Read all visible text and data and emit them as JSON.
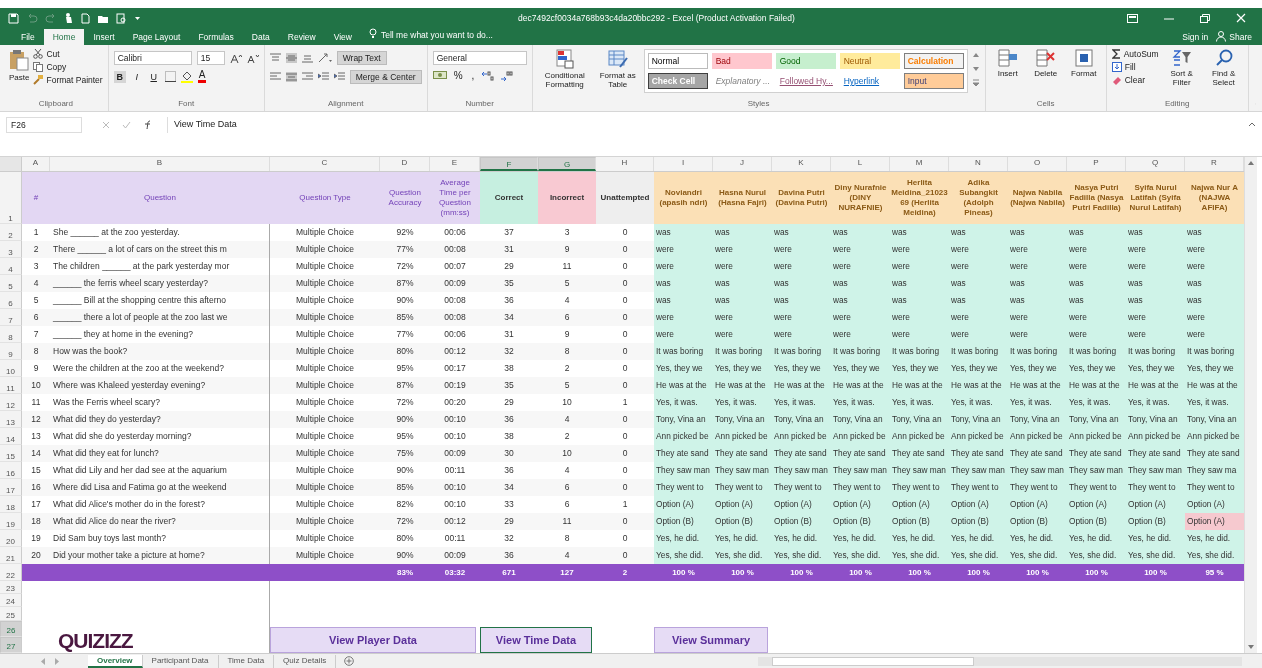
{
  "window": {
    "title": "dec7492cf0034a768b93c4da20bbc292 - Excel (Product Activation Failed)"
  },
  "menu_tabs": [
    {
      "label": "File",
      "selected": false
    },
    {
      "label": "Home",
      "selected": true
    },
    {
      "label": "Insert",
      "selected": false
    },
    {
      "label": "Page Layout",
      "selected": false
    },
    {
      "label": "Formulas",
      "selected": false
    },
    {
      "label": "Data",
      "selected": false
    },
    {
      "label": "Review",
      "selected": false
    },
    {
      "label": "View",
      "selected": false
    }
  ],
  "tell_me": "Tell me what you want to do...",
  "account": {
    "sign_in": "Sign in",
    "share": "Share"
  },
  "ribbon": {
    "clipboard": {
      "paste": "Paste",
      "cut": "Cut",
      "copy": "Copy",
      "format_painter": "Format Painter",
      "label": "Clipboard"
    },
    "font": {
      "name": "Calibri",
      "size": "15",
      "bold": "B",
      "italic": "I",
      "underline": "U",
      "font_color": "A",
      "label": "Font"
    },
    "alignment": {
      "wrap": "Wrap Text",
      "merge": "Merge & Center",
      "label": "Alignment"
    },
    "number": {
      "format": "General",
      "percent": "%",
      "comma": ",",
      "label": "Number"
    },
    "styles": {
      "conditional": "Conditional Formatting",
      "format_table": "Format as Table",
      "label": "Styles",
      "gallery": [
        {
          "label": "Normal",
          "kind": "normal"
        },
        {
          "label": "Bad",
          "kind": "bad"
        },
        {
          "label": "Good",
          "kind": "good"
        },
        {
          "label": "Neutral",
          "kind": "neutral"
        },
        {
          "label": "Calculation",
          "kind": "calculation"
        },
        {
          "label": "Check Cell",
          "kind": "check"
        },
        {
          "label": "Explanatory ...",
          "kind": "explanatory"
        },
        {
          "label": "Followed Hy...",
          "kind": "followed"
        },
        {
          "label": "Hyperlink",
          "kind": "hyperlink"
        },
        {
          "label": "Input",
          "kind": "input"
        }
      ]
    },
    "cells": {
      "insert": "Insert",
      "delete": "Delete",
      "format": "Format",
      "label": "Cells"
    },
    "editing": {
      "autosum": "AutoSum",
      "fill": "Fill",
      "clear": "Clear",
      "sort": "Sort & Filter",
      "find": "Find & Select",
      "label": "Editing"
    }
  },
  "formula_bar": {
    "name_box": "F26",
    "content": "View Time Data"
  },
  "sheet": {
    "columns": [
      {
        "letter": "A",
        "selected": false
      },
      {
        "letter": "B",
        "selected": false
      },
      {
        "letter": "C",
        "selected": false
      },
      {
        "letter": "D",
        "selected": false
      },
      {
        "letter": "E",
        "selected": false
      },
      {
        "letter": "F",
        "selected": true
      },
      {
        "letter": "G",
        "selected": true
      },
      {
        "letter": "H",
        "selected": false
      },
      {
        "letter": "I",
        "selected": false
      },
      {
        "letter": "J",
        "selected": false
      },
      {
        "letter": "K",
        "selected": false
      },
      {
        "letter": "L",
        "selected": false
      },
      {
        "letter": "M",
        "selected": false
      },
      {
        "letter": "N",
        "selected": false
      },
      {
        "letter": "O",
        "selected": false
      },
      {
        "letter": "P",
        "selected": false
      },
      {
        "letter": "Q",
        "selected": false
      },
      {
        "letter": "R",
        "selected": false
      }
    ],
    "row_headers": [
      {
        "label": "1",
        "selected": false
      },
      {
        "label": "2",
        "selected": false
      },
      {
        "label": "3",
        "selected": false
      },
      {
        "label": "4",
        "selected": false
      },
      {
        "label": "5",
        "selected": false
      },
      {
        "label": "6",
        "selected": false
      },
      {
        "label": "7",
        "selected": false
      },
      {
        "label": "8",
        "selected": false
      },
      {
        "label": "9",
        "selected": false
      },
      {
        "label": "10",
        "selected": false
      },
      {
        "label": "11",
        "selected": false
      },
      {
        "label": "12",
        "selected": false
      },
      {
        "label": "13",
        "selected": false
      },
      {
        "label": "14",
        "selected": false
      },
      {
        "label": "15",
        "selected": false
      },
      {
        "label": "16",
        "selected": false
      },
      {
        "label": "17",
        "selected": false
      },
      {
        "label": "18",
        "selected": false
      },
      {
        "label": "19",
        "selected": false
      },
      {
        "label": "20",
        "selected": false
      },
      {
        "label": "21",
        "selected": false
      },
      {
        "label": "22",
        "selected": false
      },
      {
        "label": "23",
        "selected": false
      },
      {
        "label": "24",
        "selected": false
      },
      {
        "label": "25",
        "selected": false
      },
      {
        "label": "26",
        "selected": true
      },
      {
        "label": "27",
        "selected": true
      }
    ],
    "header": [
      {
        "label": "#",
        "kind": "info"
      },
      {
        "label": "Question",
        "kind": "info"
      },
      {
        "label": "Question Type",
        "kind": "info"
      },
      {
        "label": "Question Accuracy",
        "kind": "info"
      },
      {
        "label": "Average Time per Question (mm:ss)",
        "kind": "info"
      },
      {
        "label": "Correct",
        "kind": "correct"
      },
      {
        "label": "Incorrect",
        "kind": "incorrect"
      },
      {
        "label": "Unattempted",
        "kind": "unattempted"
      }
    ],
    "players": [
      "Noviandri (apasih ndri)",
      "Hasna Nurul (Hasna Fajri)",
      "Davina Putri (Davina Putri)",
      "Diny Nurafnie (DINY NURAFNIE)",
      "Herlita Meidina_2102369 (Herlita Meidina)",
      "Adika Subangkit (Adolph Pineas)",
      "Najwa Nabila (Najwa Nabila)",
      "Nasya Putri Fadilla (Nasya Putri Fadilla)",
      "Syifa Nurul Latifah (Syifa Nurul Latifah)",
      "Najwa Nur A (NAJWA AFIFA)"
    ],
    "rows": [
      {
        "num": "1",
        "question": "She ______ at the zoo yesterday.",
        "type": "Multiple Choice",
        "accuracy": "92%",
        "time": "00:06",
        "correct": "37",
        "incorrect": "3",
        "unattempted": "0",
        "answers": [
          {
            "text": "was",
            "correct": true
          },
          {
            "text": "was",
            "correct": true
          },
          {
            "text": "was",
            "correct": true
          },
          {
            "text": "was",
            "correct": true
          },
          {
            "text": "was",
            "correct": true
          },
          {
            "text": "was",
            "correct": true
          },
          {
            "text": "was",
            "correct": true
          },
          {
            "text": "was",
            "correct": true
          },
          {
            "text": "was",
            "correct": true
          },
          {
            "text": "was",
            "correct": true
          }
        ]
      },
      {
        "num": "2",
        "question": "There ______ a lot of cars on the street this m",
        "type": "Multiple Choice",
        "accuracy": "77%",
        "time": "00:08",
        "correct": "31",
        "incorrect": "9",
        "unattempted": "0",
        "answers": [
          {
            "text": "were",
            "correct": true
          },
          {
            "text": "were",
            "correct": true
          },
          {
            "text": "were",
            "correct": true
          },
          {
            "text": "were",
            "correct": true
          },
          {
            "text": "were",
            "correct": true
          },
          {
            "text": "were",
            "correct": true
          },
          {
            "text": "were",
            "correct": true
          },
          {
            "text": "were",
            "correct": true
          },
          {
            "text": "were",
            "correct": true
          },
          {
            "text": "were",
            "correct": true
          }
        ]
      },
      {
        "num": "3",
        "question": "The children ______ at the park yesterday mor",
        "type": "Multiple Choice",
        "accuracy": "72%",
        "time": "00:07",
        "correct": "29",
        "incorrect": "11",
        "unattempted": "0",
        "answers": [
          {
            "text": "were",
            "correct": true
          },
          {
            "text": "were",
            "correct": true
          },
          {
            "text": "were",
            "correct": true
          },
          {
            "text": "were",
            "correct": true
          },
          {
            "text": "were",
            "correct": true
          },
          {
            "text": "were",
            "correct": true
          },
          {
            "text": "were",
            "correct": true
          },
          {
            "text": "were",
            "correct": true
          },
          {
            "text": "were",
            "correct": true
          },
          {
            "text": "were",
            "correct": true
          }
        ]
      },
      {
        "num": "4",
        "question": "______ the ferris wheel scary yesterday?",
        "type": "Multiple Choice",
        "accuracy": "87%",
        "time": "00:09",
        "correct": "35",
        "incorrect": "5",
        "unattempted": "0",
        "answers": [
          {
            "text": "was",
            "correct": true
          },
          {
            "text": "was",
            "correct": true
          },
          {
            "text": "was",
            "correct": true
          },
          {
            "text": "was",
            "correct": true
          },
          {
            "text": "was",
            "correct": true
          },
          {
            "text": "was",
            "correct": true
          },
          {
            "text": "was",
            "correct": true
          },
          {
            "text": "was",
            "correct": true
          },
          {
            "text": "was",
            "correct": true
          },
          {
            "text": "was",
            "correct": true
          }
        ]
      },
      {
        "num": "5",
        "question": "______ Bill at the shopping centre this afterno",
        "type": "Multiple Choice",
        "accuracy": "90%",
        "time": "00:08",
        "correct": "36",
        "incorrect": "4",
        "unattempted": "0",
        "answers": [
          {
            "text": "was",
            "correct": true
          },
          {
            "text": "was",
            "correct": true
          },
          {
            "text": "was",
            "correct": true
          },
          {
            "text": "was",
            "correct": true
          },
          {
            "text": "was",
            "correct": true
          },
          {
            "text": "was",
            "correct": true
          },
          {
            "text": "was",
            "correct": true
          },
          {
            "text": "was",
            "correct": true
          },
          {
            "text": "was",
            "correct": true
          },
          {
            "text": "was",
            "correct": true
          }
        ]
      },
      {
        "num": "6",
        "question": "______ there a lot of people at the zoo last we",
        "type": "Multiple Choice",
        "accuracy": "85%",
        "time": "00:08",
        "correct": "34",
        "incorrect": "6",
        "unattempted": "0",
        "answers": [
          {
            "text": "were",
            "correct": true
          },
          {
            "text": "were",
            "correct": true
          },
          {
            "text": "were",
            "correct": true
          },
          {
            "text": "were",
            "correct": true
          },
          {
            "text": "were",
            "correct": true
          },
          {
            "text": "were",
            "correct": true
          },
          {
            "text": "were",
            "correct": true
          },
          {
            "text": "were",
            "correct": true
          },
          {
            "text": "were",
            "correct": true
          },
          {
            "text": "were",
            "correct": true
          }
        ]
      },
      {
        "num": "7",
        "question": "______ they at home in the evening?",
        "type": "Multiple Choice",
        "accuracy": "77%",
        "time": "00:06",
        "correct": "31",
        "incorrect": "9",
        "unattempted": "0",
        "answers": [
          {
            "text": "were",
            "correct": true
          },
          {
            "text": "were",
            "correct": true
          },
          {
            "text": "were",
            "correct": true
          },
          {
            "text": "were",
            "correct": true
          },
          {
            "text": "were",
            "correct": true
          },
          {
            "text": "were",
            "correct": true
          },
          {
            "text": "were",
            "correct": true
          },
          {
            "text": "were",
            "correct": true
          },
          {
            "text": "were",
            "correct": true
          },
          {
            "text": "were",
            "correct": true
          }
        ]
      },
      {
        "num": "8",
        "question": "How was the book?",
        "type": "Multiple Choice",
        "accuracy": "80%",
        "time": "00:12",
        "correct": "32",
        "incorrect": "8",
        "unattempted": "0",
        "answers": [
          {
            "text": "It was boring",
            "correct": true
          },
          {
            "text": "It was boring",
            "correct": true
          },
          {
            "text": "It was boring",
            "correct": true
          },
          {
            "text": "It was boring",
            "correct": true
          },
          {
            "text": "It was boring",
            "correct": true
          },
          {
            "text": "It was boring",
            "correct": true
          },
          {
            "text": "It was boring",
            "correct": true
          },
          {
            "text": "It was boring",
            "correct": true
          },
          {
            "text": "It was boring",
            "correct": true
          },
          {
            "text": "It was boring",
            "correct": true
          }
        ]
      },
      {
        "num": "9",
        "question": "Were the children at the zoo at the weekend?",
        "type": "Multiple Choice",
        "accuracy": "95%",
        "time": "00:17",
        "correct": "38",
        "incorrect": "2",
        "unattempted": "0",
        "answers": [
          {
            "text": "Yes, they we",
            "correct": true
          },
          {
            "text": "Yes, they we",
            "correct": true
          },
          {
            "text": "Yes, they we",
            "correct": true
          },
          {
            "text": "Yes, they we",
            "correct": true
          },
          {
            "text": "Yes, they we",
            "correct": true
          },
          {
            "text": "Yes, they we",
            "correct": true
          },
          {
            "text": "Yes, they we",
            "correct": true
          },
          {
            "text": "Yes, they we",
            "correct": true
          },
          {
            "text": "Yes, they we",
            "correct": true
          },
          {
            "text": "Yes, they we",
            "correct": true
          }
        ]
      },
      {
        "num": "10",
        "question": "Where was Khaleed yesterday evening?",
        "type": "Multiple Choice",
        "accuracy": "87%",
        "time": "00:19",
        "correct": "35",
        "incorrect": "5",
        "unattempted": "0",
        "answers": [
          {
            "text": "He was at the",
            "correct": true
          },
          {
            "text": "He was at the",
            "correct": true
          },
          {
            "text": "He was at the",
            "correct": true
          },
          {
            "text": "He was at the",
            "correct": true
          },
          {
            "text": "He was at the",
            "correct": true
          },
          {
            "text": "He was at the",
            "correct": true
          },
          {
            "text": "He was at the",
            "correct": true
          },
          {
            "text": "He was at the",
            "correct": true
          },
          {
            "text": "He was at the",
            "correct": true
          },
          {
            "text": "He was at the",
            "correct": true
          }
        ]
      },
      {
        "num": "11",
        "question": "Was the Ferris wheel scary?",
        "type": "Multiple Choice",
        "accuracy": "72%",
        "time": "00:20",
        "correct": "29",
        "incorrect": "10",
        "unattempted": "1",
        "answers": [
          {
            "text": "Yes, it was.",
            "correct": true
          },
          {
            "text": "Yes, it was.",
            "correct": true
          },
          {
            "text": "Yes, it was.",
            "correct": true
          },
          {
            "text": "Yes, it was.",
            "correct": true
          },
          {
            "text": "Yes, it was.",
            "correct": true
          },
          {
            "text": "Yes, it was.",
            "correct": true
          },
          {
            "text": "Yes, it was.",
            "correct": true
          },
          {
            "text": "Yes, it was.",
            "correct": true
          },
          {
            "text": "Yes, it was.",
            "correct": true
          },
          {
            "text": "Yes, it was.",
            "correct": true
          }
        ]
      },
      {
        "num": "12",
        "question": "What did they do yesterday?",
        "type": "Multiple Choice",
        "accuracy": "90%",
        "time": "00:10",
        "correct": "36",
        "incorrect": "4",
        "unattempted": "0",
        "answers": [
          {
            "text": "Tony, Vina an",
            "correct": true
          },
          {
            "text": "Tony, Vina an",
            "correct": true
          },
          {
            "text": "Tony, Vina an",
            "correct": true
          },
          {
            "text": "Tony, Vina an",
            "correct": true
          },
          {
            "text": "Tony, Vina an",
            "correct": true
          },
          {
            "text": "Tony, Vina an",
            "correct": true
          },
          {
            "text": "Tony, Vina an",
            "correct": true
          },
          {
            "text": "Tony, Vina an",
            "correct": true
          },
          {
            "text": "Tony, Vina an",
            "correct": true
          },
          {
            "text": "Tony, Vina an",
            "correct": true
          }
        ]
      },
      {
        "num": "13",
        "question": "What did she do yesterday morning?",
        "type": "Multiple Choice",
        "accuracy": "95%",
        "time": "00:10",
        "correct": "38",
        "incorrect": "2",
        "unattempted": "0",
        "answers": [
          {
            "text": "Ann picked be",
            "correct": true
          },
          {
            "text": "Ann picked be",
            "correct": true
          },
          {
            "text": "Ann picked be",
            "correct": true
          },
          {
            "text": "Ann picked be",
            "correct": true
          },
          {
            "text": "Ann picked be",
            "correct": true
          },
          {
            "text": "Ann picked be",
            "correct": true
          },
          {
            "text": "Ann picked be",
            "correct": true
          },
          {
            "text": "Ann picked be",
            "correct": true
          },
          {
            "text": "Ann picked be",
            "correct": true
          },
          {
            "text": "Ann picked be",
            "correct": true
          }
        ]
      },
      {
        "num": "14",
        "question": "What did they eat for lunch?",
        "type": "Multiple Choice",
        "accuracy": "75%",
        "time": "00:09",
        "correct": "30",
        "incorrect": "10",
        "unattempted": "0",
        "answers": [
          {
            "text": "They ate sand",
            "correct": true
          },
          {
            "text": "They ate sand",
            "correct": true
          },
          {
            "text": "They ate sand",
            "correct": true
          },
          {
            "text": "They ate sand",
            "correct": true
          },
          {
            "text": "They ate sand",
            "correct": true
          },
          {
            "text": "They ate sand",
            "correct": true
          },
          {
            "text": "They ate sand",
            "correct": true
          },
          {
            "text": "They ate sand",
            "correct": true
          },
          {
            "text": "They ate sand",
            "correct": true
          },
          {
            "text": "They ate sand",
            "correct": true
          }
        ]
      },
      {
        "num": "15",
        "question": "What did Lily and her dad see at the aquarium",
        "type": "Multiple Choice",
        "accuracy": "90%",
        "time": "00:11",
        "correct": "36",
        "incorrect": "4",
        "unattempted": "0",
        "answers": [
          {
            "text": "They saw man",
            "correct": true
          },
          {
            "text": "They saw man",
            "correct": true
          },
          {
            "text": "They saw man",
            "correct": true
          },
          {
            "text": "They saw man",
            "correct": true
          },
          {
            "text": "They saw man",
            "correct": true
          },
          {
            "text": "They saw man",
            "correct": true
          },
          {
            "text": "They saw man",
            "correct": true
          },
          {
            "text": "They saw man",
            "correct": true
          },
          {
            "text": "They saw man",
            "correct": true
          },
          {
            "text": "They saw ma",
            "correct": true
          }
        ]
      },
      {
        "num": "16",
        "question": "Where did Lisa and Fatima go at the weekend",
        "type": "Multiple Choice",
        "accuracy": "85%",
        "time": "00:10",
        "correct": "34",
        "incorrect": "6",
        "unattempted": "0",
        "answers": [
          {
            "text": "They went to",
            "correct": true
          },
          {
            "text": "They went to",
            "correct": true
          },
          {
            "text": "They went to",
            "correct": true
          },
          {
            "text": "They went to",
            "correct": true
          },
          {
            "text": "They went to",
            "correct": true
          },
          {
            "text": "They went to",
            "correct": true
          },
          {
            "text": "They went to",
            "correct": true
          },
          {
            "text": "They went to",
            "correct": true
          },
          {
            "text": "They went to",
            "correct": true
          },
          {
            "text": "They went to",
            "correct": true
          }
        ]
      },
      {
        "num": "17",
        "question": "What did Alice's mother do in the forest?",
        "type": "Multiple Choice",
        "accuracy": "82%",
        "time": "00:10",
        "correct": "33",
        "incorrect": "6",
        "unattempted": "1",
        "answers": [
          {
            "text": "Option (A)",
            "correct": true
          },
          {
            "text": "Option (A)",
            "correct": true
          },
          {
            "text": "Option (A)",
            "correct": true
          },
          {
            "text": "Option (A)",
            "correct": true
          },
          {
            "text": "Option (A)",
            "correct": true
          },
          {
            "text": "Option (A)",
            "correct": true
          },
          {
            "text": "Option (A)",
            "correct": true
          },
          {
            "text": "Option (A)",
            "correct": true
          },
          {
            "text": "Option (A)",
            "correct": true
          },
          {
            "text": "Option (A)",
            "correct": true
          }
        ]
      },
      {
        "num": "18",
        "question": "What did Alice do near the river?",
        "type": "Multiple Choice",
        "accuracy": "72%",
        "time": "00:12",
        "correct": "29",
        "incorrect": "11",
        "unattempted": "0",
        "answers": [
          {
            "text": "Option (B)",
            "correct": true
          },
          {
            "text": "Option (B)",
            "correct": true
          },
          {
            "text": "Option (B)",
            "correct": true
          },
          {
            "text": "Option (B)",
            "correct": true
          },
          {
            "text": "Option (B)",
            "correct": true
          },
          {
            "text": "Option (B)",
            "correct": true
          },
          {
            "text": "Option (B)",
            "correct": true
          },
          {
            "text": "Option (B)",
            "correct": true
          },
          {
            "text": "Option (B)",
            "correct": true
          },
          {
            "text": "Option (A)",
            "correct": false
          }
        ]
      },
      {
        "num": "19",
        "question": "Did Sam buy toys last month?",
        "type": "Multiple Choice",
        "accuracy": "80%",
        "time": "00:11",
        "correct": "32",
        "incorrect": "8",
        "unattempted": "0",
        "answers": [
          {
            "text": "Yes, he did.",
            "correct": true
          },
          {
            "text": "Yes, he did.",
            "correct": true
          },
          {
            "text": "Yes, he did.",
            "correct": true
          },
          {
            "text": "Yes, he did.",
            "correct": true
          },
          {
            "text": "Yes, he did.",
            "correct": true
          },
          {
            "text": "Yes, he did.",
            "correct": true
          },
          {
            "text": "Yes, he did.",
            "correct": true
          },
          {
            "text": "Yes, he did.",
            "correct": true
          },
          {
            "text": "Yes, he did.",
            "correct": true
          },
          {
            "text": "Yes, he did.",
            "correct": true
          }
        ]
      },
      {
        "num": "20",
        "question": "Did your mother take a picture at home?",
        "type": "Multiple Choice",
        "accuracy": "90%",
        "time": "00:09",
        "correct": "36",
        "incorrect": "4",
        "unattempted": "0",
        "answers": [
          {
            "text": "Yes, she did.",
            "correct": true
          },
          {
            "text": "Yes, she did.",
            "correct": true
          },
          {
            "text": "Yes, she did.",
            "correct": true
          },
          {
            "text": "Yes, she did.",
            "correct": true
          },
          {
            "text": "Yes, she did.",
            "correct": true
          },
          {
            "text": "Yes, she did.",
            "correct": true
          },
          {
            "text": "Yes, she did.",
            "correct": true
          },
          {
            "text": "Yes, she did.",
            "correct": true
          },
          {
            "text": "Yes, she did.",
            "correct": true
          },
          {
            "text": "Yes, she did.",
            "correct": true
          }
        ]
      }
    ],
    "totals": {
      "accuracy": "83%",
      "time": "03:32",
      "correct": "671",
      "incorrect": "127",
      "unattempted": "2",
      "players": [
        "100 %",
        "100 %",
        "100 %",
        "100 %",
        "100 %",
        "100 %",
        "100 %",
        "100 %",
        "100 %",
        "95 %"
      ]
    },
    "logo": "QUIZIZZ",
    "links": [
      {
        "label": "View Player Data",
        "selected": false
      },
      {
        "label": "View Time Data",
        "selected": true
      },
      {
        "label": "View Summary",
        "selected": false
      }
    ]
  },
  "sheet_tabs": [
    {
      "label": "Overview",
      "selected": true
    },
    {
      "label": "Participant Data",
      "selected": false
    },
    {
      "label": "Time Data",
      "selected": false
    },
    {
      "label": "Quiz Details",
      "selected": false
    }
  ]
}
